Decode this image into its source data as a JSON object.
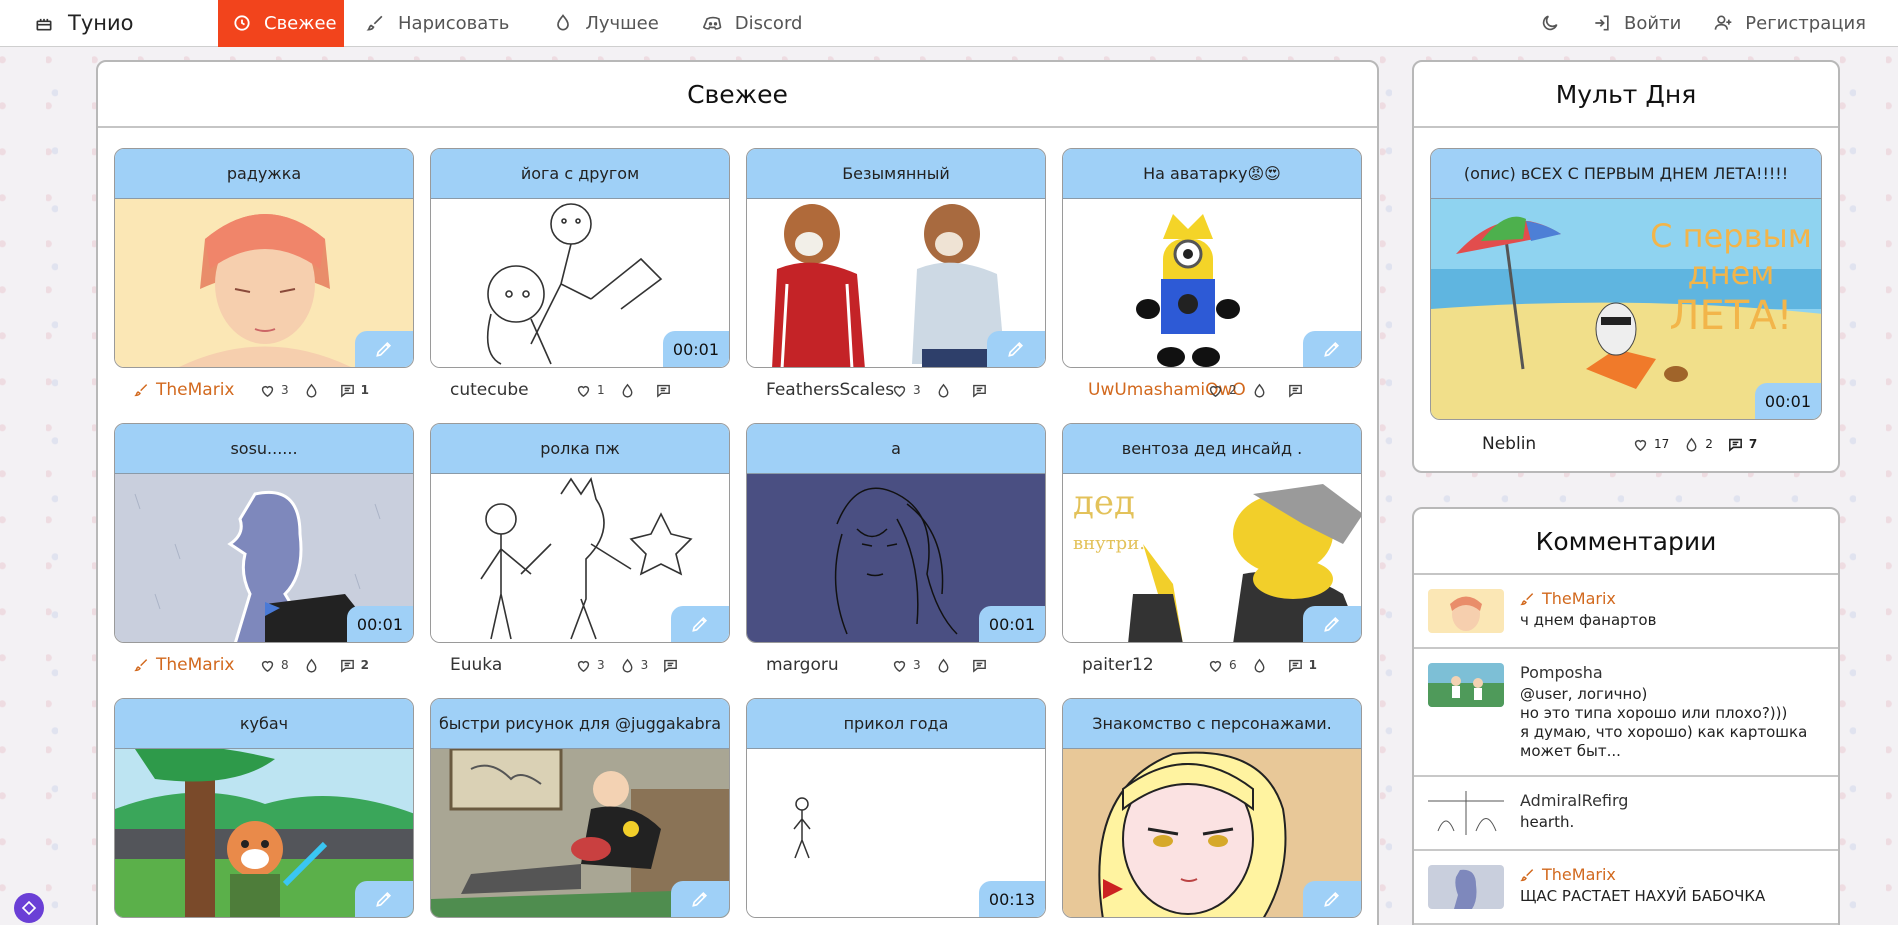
{
  "nav": {
    "brand": "Тунио",
    "items": [
      {
        "label": "Свежее",
        "icon": "history-icon",
        "active": true
      },
      {
        "label": "Нарисовать",
        "icon": "brush-icon"
      },
      {
        "label": "Лучшее",
        "icon": "flame-icon"
      },
      {
        "label": "Discord",
        "icon": "discord-icon"
      }
    ],
    "login": "Войти",
    "register": "Регистрация"
  },
  "main": {
    "title": "Свежее",
    "cards": [
      {
        "title": "радужка",
        "author": "TheMarix",
        "orange": true,
        "likes": "3",
        "fires": "",
        "comments": "1",
        "badge": "pen"
      },
      {
        "title": "йога с другом",
        "author": "cutecube",
        "orange": false,
        "likes": "1",
        "fires": "",
        "comments": "",
        "badge": "00:01"
      },
      {
        "title": "Безымянный",
        "author": "FeathersScales",
        "orange": false,
        "likes": "3",
        "fires": "",
        "comments": "",
        "badge": "pen"
      },
      {
        "title": "На аватарку😡😍",
        "author": "UwUmashamiOwO",
        "orange": true,
        "likes": "2",
        "fires": "",
        "comments": "",
        "badge": "pen"
      },
      {
        "title": "sosu......",
        "author": "TheMarix",
        "orange": true,
        "likes": "8",
        "fires": "",
        "comments": "2",
        "badge": "00:01"
      },
      {
        "title": "ролка пж",
        "author": "Euuka",
        "orange": false,
        "likes": "3",
        "fires": "3",
        "comments": "",
        "badge": "pen"
      },
      {
        "title": "а",
        "author": "margoru",
        "orange": false,
        "likes": "3",
        "fires": "",
        "comments": "",
        "badge": "00:01"
      },
      {
        "title": "вентоза дед инсайд .",
        "author": "paiter12",
        "orange": false,
        "likes": "6",
        "fires": "",
        "comments": "1",
        "badge": "pen"
      },
      {
        "title": "кубач",
        "author": "",
        "orange": false,
        "likes": "",
        "fires": "",
        "comments": "",
        "badge": "pen"
      },
      {
        "title": "быстри рисунок для @juggakabra",
        "author": "",
        "orange": false,
        "likes": "",
        "fires": "",
        "comments": "",
        "badge": "pen"
      },
      {
        "title": "прикол года",
        "author": "",
        "orange": false,
        "likes": "",
        "fires": "",
        "comments": "",
        "badge": "00:13"
      },
      {
        "title": "Знакомство с персонажами.",
        "author": "",
        "orange": false,
        "likes": "",
        "fires": "",
        "comments": "",
        "badge": "pen"
      }
    ]
  },
  "day": {
    "title": "Мульт Дня",
    "card_title": "(опис) вСЕХ С ПЕРВЫМ ДНЕМ ЛЕТА!!!!!",
    "image_text": [
      "С первым",
      "днем",
      "ЛЕТА!"
    ],
    "duration": "00:01",
    "author": "Neblin",
    "likes": "17",
    "fires": "2",
    "comments": "7"
  },
  "comments": {
    "title": "Комментарии",
    "items": [
      {
        "author": "TheMarix",
        "orange": true,
        "text": "ч днем фанартов"
      },
      {
        "author": "Pomposha",
        "orange": false,
        "text": "@user, логично)\nно это типа хорошо или плохо?)))\nя думаю, что хорошо) как картошка\nможет быт..."
      },
      {
        "author": "AdmiralRefirg",
        "orange": false,
        "text": "hearth."
      },
      {
        "author": "TheMarix",
        "orange": true,
        "text": "ЩАС РАСТАЕТ НАХУЙ БАБОЧКА"
      }
    ]
  },
  "image_text": {
    "ded": "дед",
    "vnutri": "внутри."
  }
}
